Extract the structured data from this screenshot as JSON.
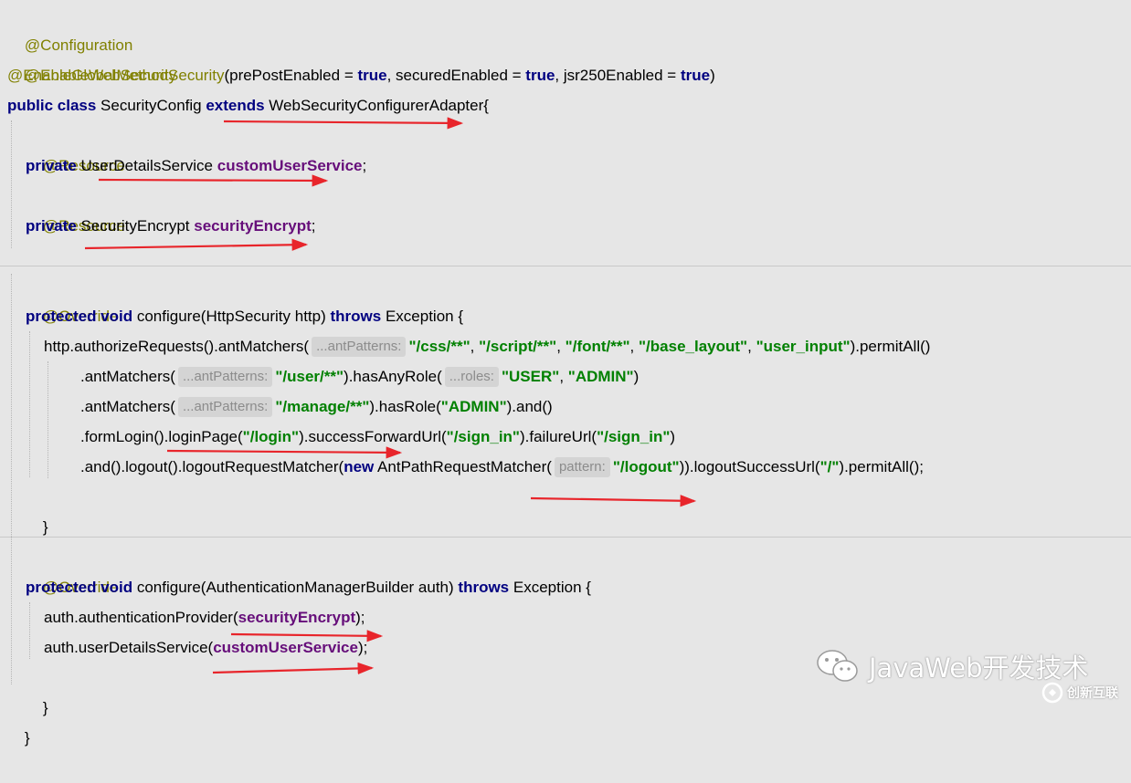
{
  "code": {
    "l1": "@Configuration",
    "l2": "@EnableWebSecurity",
    "l3": {
      "ann": "@EnableGlobalMethodSecurity",
      "t1": "(prePostEnabled = ",
      "v1": "true",
      "t2": ", securedEnabled = ",
      "v2": "true",
      "t3": ", jsr250Enabled = ",
      "v3": "true",
      "t4": ")"
    },
    "l4": {
      "k1": "public class",
      "t1": " SecurityConfig ",
      "k2": "extends",
      "t2": " WebSecurityConfigurerAdapter{"
    },
    "l5": "@Resource",
    "l6": {
      "k": "private",
      "t": " UserDetailsService ",
      "f": "customUserService",
      "e": ";"
    },
    "l7": "@Resource",
    "l8": {
      "k": "private",
      "t": " SecurityEncrypt ",
      "f": "securityEncrypt",
      "e": ";"
    },
    "l9": "@Override",
    "l10": {
      "k1": "protected void",
      "t1": " configure(HttpSecurity http) ",
      "k2": "throws",
      "t2": " Exception {"
    },
    "l11": {
      "t1": "http.authorizeRequests().antMatchers(",
      "hint": "...antPatterns:",
      "s1": "\"/css/**\"",
      "c1": ", ",
      "s2": "\"/script/**\"",
      "c2": ", ",
      "s3": "\"/font/**\"",
      "c3": ", ",
      "s4": "\"/base_layout\"",
      "c4": ", ",
      "s5": "\"user_input\"",
      "t2": ").permitAll()"
    },
    "l12": {
      "t1": ".antMatchers(",
      "hint1": "...antPatterns:",
      "s1": "\"/user/**\"",
      "t2": ").hasAnyRole(",
      "hint2": "...roles:",
      "s2": "\"USER\"",
      "c1": ", ",
      "s3": "\"ADMIN\"",
      "t3": ")"
    },
    "l13": {
      "t1": ".antMatchers(",
      "hint": "...antPatterns:",
      "s1": "\"/manage/**\"",
      "t2": ").hasRole(",
      "s2": "\"ADMIN\"",
      "t3": ").and()"
    },
    "l14": {
      "t1": ".formLogin().loginPage(",
      "s1": "\"/login\"",
      "t2": ").successForwardUrl(",
      "s2": "\"/sign_in\"",
      "t3": ").failureUrl(",
      "s3": "\"/sign_in\"",
      "t4": ")"
    },
    "l15": {
      "t1": ".and().logout().logoutRequestMatcher(",
      "k": "new",
      "t2": " AntPathRequestMatcher(",
      "hint": "pattern:",
      "s1": "\"/logout\"",
      "t3": ")).logoutSuccessUrl(",
      "s2": "\"/\"",
      "t4": ").permitAll();"
    },
    "l16": "}",
    "l17": "@Override",
    "l18": {
      "k1": "protected void",
      "t1": " configure(AuthenticationManagerBuilder auth) ",
      "k2": "throws",
      "t2": " Exception {"
    },
    "l19": {
      "t1": "auth.authenticationProvider(",
      "f": "securityEncrypt",
      "t2": ");"
    },
    "l20": {
      "t1": "auth.userDetailsService(",
      "f": "customUserService",
      "t2": ");"
    },
    "l21": "}",
    "l22": "}"
  },
  "watermark": {
    "text": "JavaWeb开发技术",
    "logo_icon": "wechat-icon",
    "brand": "创新互联",
    "brand_icon": "brand-logo-icon"
  },
  "colors": {
    "background": "#e6e6e6",
    "annotation": "#808000",
    "keyword": "#000080",
    "string": "#008000",
    "field": "#660e7a",
    "arrow": "#e8252b"
  }
}
